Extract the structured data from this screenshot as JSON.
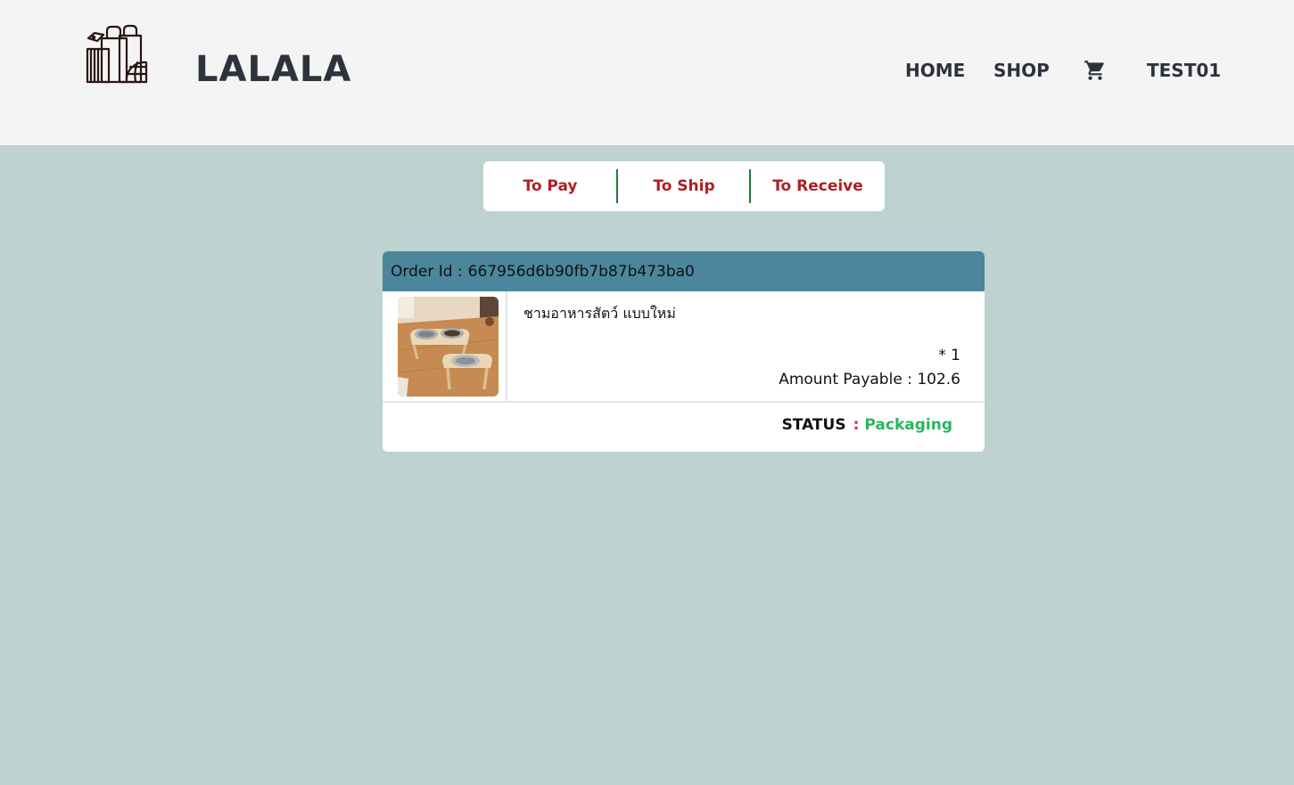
{
  "header": {
    "brand": "LALALA",
    "nav": {
      "home": "HOME",
      "shop": "SHOP",
      "user": "TEST01"
    }
  },
  "tabs": [
    {
      "label": "To Pay"
    },
    {
      "label": "To Ship"
    },
    {
      "label": "To Receive"
    }
  ],
  "order": {
    "id_label": "Order Id :",
    "id_value": "667956d6b90fb7b87b473ba0",
    "product_name": "ชามอาหารสัตว์ แบบใหม่",
    "quantity": "* 1",
    "amount_label": "Amount Payable :",
    "amount_value": "102.6",
    "status_label": "STATUS",
    "status_separator": ":",
    "status_value": "Packaging"
  },
  "colors": {
    "header_bg": "#f4f4f4",
    "page_bg": "#bed2cf",
    "brand_text": "#2e323d",
    "tab_text": "#b01e23",
    "tab_divider": "#1e7a3d",
    "order_header_bg": "#4b869c",
    "status_ok": "#2ab45e"
  },
  "icons": {
    "logo": "shopping-bags-globe-icon",
    "cart": "shopping-cart-icon"
  }
}
